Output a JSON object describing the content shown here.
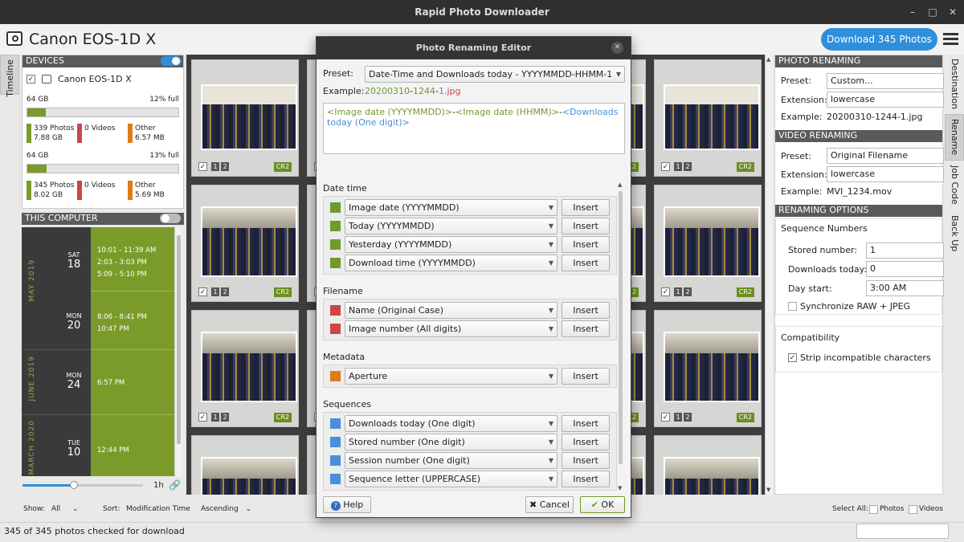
{
  "app": {
    "title": "Rapid Photo Downloader",
    "device_title": "Canon EOS-1D X",
    "download_button": "Download 345 Photos"
  },
  "left": {
    "timeline_tab": "Timeline",
    "devices_header": "DEVICES",
    "device_name": "Canon EOS-1D X",
    "storage": [
      {
        "size": "64 GB",
        "full": "12% full",
        "fill": 0.12,
        "photos": "339 Photos",
        "photos_size": "7.88 GB",
        "videos": "0 Videos",
        "other": "Other",
        "other_size": "6.57 MB"
      },
      {
        "size": "64 GB",
        "full": "13% full",
        "fill": 0.13,
        "photos": "345 Photos",
        "photos_size": "8.02 GB",
        "videos": "0 Videos",
        "other": "Other",
        "other_size": "5.69 MB"
      }
    ],
    "this_computer": "THIS COMPUTER",
    "timeline": [
      {
        "month": "MAY 2019",
        "days": [
          {
            "dow": "SAT",
            "day": "18",
            "times": [
              "10:01 - 11:39 AM",
              "2:03 - 3:03 PM",
              "5:09 - 5:10 PM"
            ]
          },
          {
            "dow": "MON",
            "day": "20",
            "times": [
              "8:06 - 8:41 PM",
              "10:47 PM"
            ]
          }
        ]
      },
      {
        "month": "JUNE 2019",
        "days": [
          {
            "dow": "MON",
            "day": "24",
            "times": [
              "6:57 PM"
            ]
          }
        ]
      },
      {
        "month": "MARCH 2020",
        "days": [
          {
            "dow": "TUE",
            "day": "10",
            "times": [
              "12:44 PM"
            ]
          }
        ]
      }
    ],
    "slider_label": "1h"
  },
  "thumbs": {
    "tag": "CR2",
    "nums": [
      "1",
      "2"
    ]
  },
  "dialog": {
    "title": "Photo Renaming Editor",
    "preset_label": "Preset:",
    "preset_value": "Date-Time and Downloads today - YYYYMMDD-HHMM-1",
    "example_label": "Example:",
    "example_parts": [
      "20200310",
      "-",
      "1244",
      "-",
      "1",
      ".jpg"
    ],
    "editor_parts": [
      "<Image date (YYYYMMDD)>",
      "-",
      "<Image date (HHMM)>",
      "-",
      "<Downloads today (One digit)>"
    ],
    "groups": [
      {
        "label": "Date time",
        "color": "#6f9b2b",
        "rows": [
          "Image date (YYYYMMDD)",
          "Today (YYYYMMDD)",
          "Yesterday (YYYYMMDD)",
          "Download time (YYYYMMDD)"
        ]
      },
      {
        "label": "Filename",
        "color": "#d04444",
        "rows": [
          "Name (Original Case)",
          "Image number (All digits)"
        ]
      },
      {
        "label": "Metadata",
        "color": "#de7b14",
        "rows": [
          "Aperture"
        ]
      },
      {
        "label": "Sequences",
        "color": "#4a8fd8",
        "rows": [
          "Downloads today (One digit)",
          "Stored number (One digit)",
          "Session number (One digit)",
          "Sequence letter (UPPERCASE)"
        ]
      }
    ],
    "insert_label": "Insert",
    "help": "Help",
    "cancel": "Cancel",
    "ok": "OK"
  },
  "right": {
    "photo_renaming": "PHOTO RENAMING",
    "preset_label": "Preset:",
    "photo_preset": "Custom...",
    "extension_label": "Extension:",
    "photo_ext": "lowercase",
    "example_label": "Example:",
    "photo_example": "20200310-1244-1.jpg",
    "video_renaming": "VIDEO RENAMING",
    "video_preset": "Original Filename",
    "video_ext": "lowercase",
    "video_example": "MVI_1234.mov",
    "renaming_options": "RENAMING OPTIONS",
    "sequence_numbers": "Sequence Numbers",
    "stored_number_label": "Stored number:",
    "stored_number": "1",
    "downloads_today_label": "Downloads today:",
    "downloads_today": "0",
    "day_start_label": "Day start:",
    "day_start": "3:00 AM",
    "sync_label": "Synchronize RAW + JPEG",
    "compatibility": "Compatibility",
    "strip_label": "Strip incompatible characters",
    "tabs": [
      "Destination",
      "Rename",
      "Job Code",
      "Back Up"
    ]
  },
  "bottom": {
    "show_label": "Show:",
    "show_value": "All",
    "sort_label": "Sort:",
    "sort_value": "Modification Time",
    "order_value": "Ascending",
    "select_all": "Select All:",
    "photos": "Photos",
    "videos": "Videos",
    "status": "345 of 345 photos checked for download"
  },
  "colors": {
    "accent": "#2f8fdc",
    "green": "#7a9b2a",
    "dark": "#343434"
  }
}
